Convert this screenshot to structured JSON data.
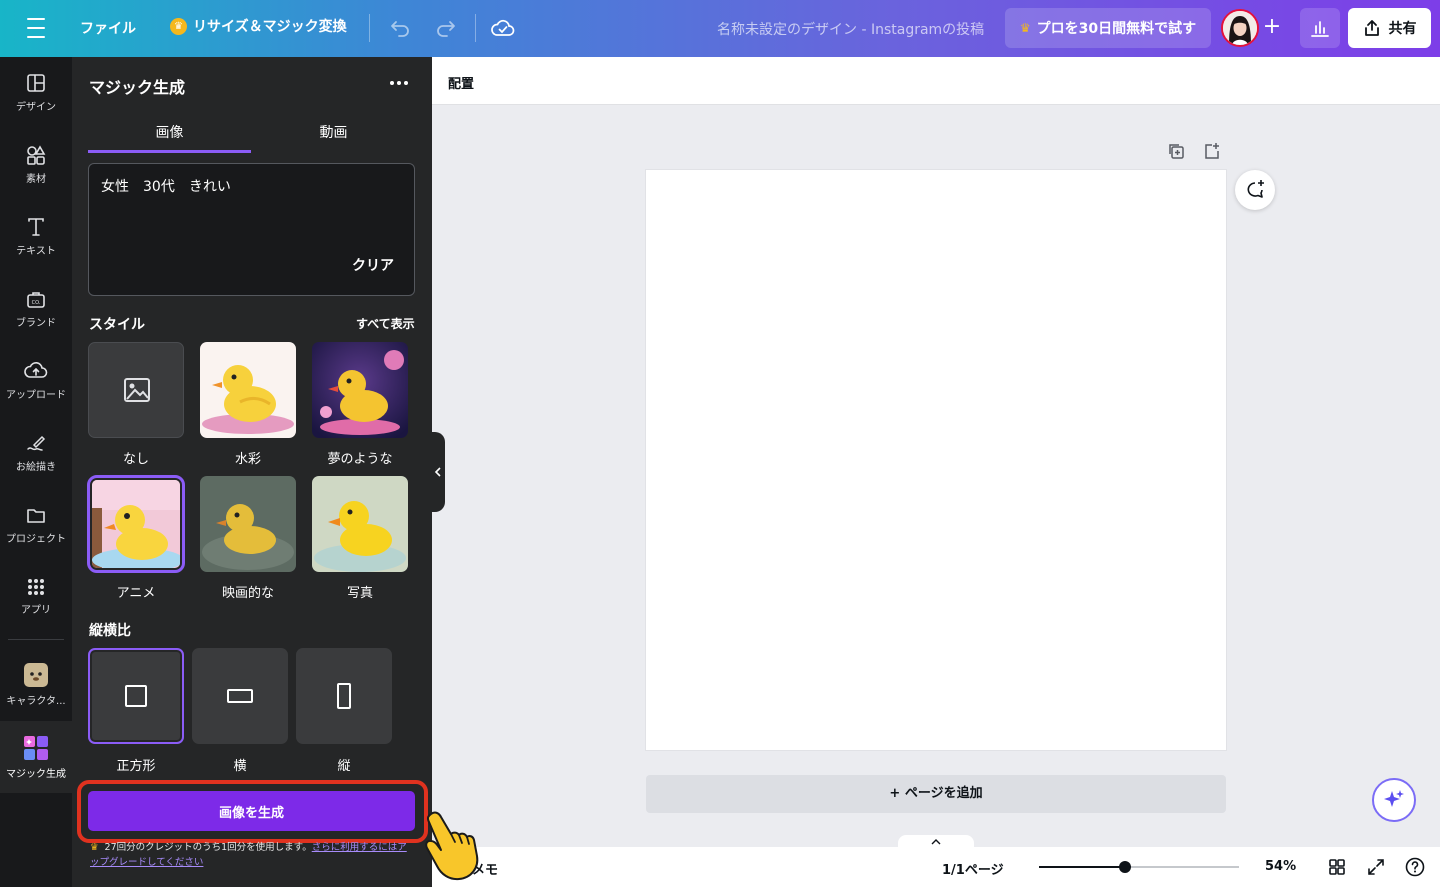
{
  "topbar": {
    "file_label": "ファイル",
    "resize_label": "リサイズ＆マジック変換",
    "doc_title": "名称未設定のデザイン - Instagramの投稿",
    "trial_label": "プロを30日間無料で試す",
    "share_label": "共有",
    "plus_label": "+"
  },
  "rail": {
    "items": [
      {
        "label": "デザイン",
        "icon": "layout-icon"
      },
      {
        "label": "素材",
        "icon": "shapes-icon"
      },
      {
        "label": "テキスト",
        "icon": "text-icon"
      },
      {
        "label": "ブランド",
        "icon": "brand-icon"
      },
      {
        "label": "アップロード",
        "icon": "upload-icon"
      },
      {
        "label": "お絵描き",
        "icon": "draw-icon"
      },
      {
        "label": "プロジェクト",
        "icon": "folder-icon"
      },
      {
        "label": "アプリ",
        "icon": "apps-icon"
      },
      {
        "label": "キャラクタ...",
        "icon": "character-icon"
      },
      {
        "label": "マジック生成",
        "icon": "magic-media-icon"
      }
    ]
  },
  "panel": {
    "title": "マジック生成",
    "tabs": [
      {
        "label": "画像",
        "active": true
      },
      {
        "label": "動画",
        "active": false
      }
    ],
    "prompt": {
      "value": "女性　30代　きれい",
      "clear_label": "クリア"
    },
    "style_heading": "スタイル",
    "see_all_label": "すべて表示",
    "styles": [
      {
        "label": "なし",
        "selected": false
      },
      {
        "label": "水彩",
        "selected": false
      },
      {
        "label": "夢のような",
        "selected": false
      },
      {
        "label": "アニメ",
        "selected": true
      },
      {
        "label": "映画的な",
        "selected": false
      },
      {
        "label": "写真",
        "selected": false
      }
    ],
    "ratio_heading": "縦横比",
    "ratios": [
      {
        "label": "正方形",
        "selected": true
      },
      {
        "label": "横",
        "selected": false
      },
      {
        "label": "縦",
        "selected": false
      }
    ],
    "generate_label": "画像を生成",
    "credit_text": "27回分のクレジットのうち1回分を使用します。",
    "credit_link": "さらに利用するにはアップグレードしてください"
  },
  "canvas": {
    "arrange_label": "配置",
    "add_page_label": "+ ページを追加"
  },
  "bottombar": {
    "memo_label": "メモ",
    "pages_label": "1/1ページ",
    "zoom_label": "54%",
    "zoom_value": 0.43
  },
  "colors": {
    "accent": "#7d2ae8",
    "highlight": "#e0321f",
    "panel_bg": "#252627",
    "rail_bg": "#18191b"
  }
}
